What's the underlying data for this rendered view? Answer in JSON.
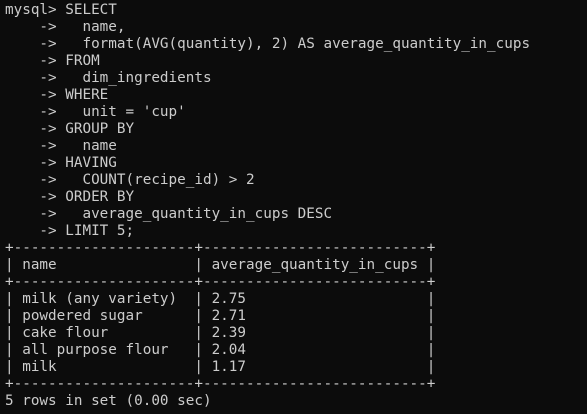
{
  "colors": {
    "background": "#0c0c0c",
    "foreground": "#cccccc"
  },
  "terminal": {
    "lines": [
      "mysql> SELECT",
      "    ->   name,",
      "    ->   format(AVG(quantity), 2) AS average_quantity_in_cups",
      "    -> FROM",
      "    ->   dim_ingredients",
      "    -> WHERE",
      "    ->   unit = 'cup'",
      "    -> GROUP BY",
      "    ->   name",
      "    -> HAVING",
      "    ->   COUNT(recipe_id) > 2",
      "    -> ORDER BY",
      "    ->   average_quantity_in_cups DESC",
      "    -> LIMIT 5;",
      "+---------------------+--------------------------+",
      "| name                | average_quantity_in_cups |",
      "+---------------------+--------------------------+",
      "| milk (any variety)  | 2.75                     |",
      "| powdered sugar      | 2.71                     |",
      "| cake flour          | 2.39                     |",
      "| all purpose flour   | 2.04                     |",
      "| milk                | 1.17                     |",
      "+---------------------+--------------------------+",
      "5 rows in set (0.00 sec)"
    ]
  }
}
